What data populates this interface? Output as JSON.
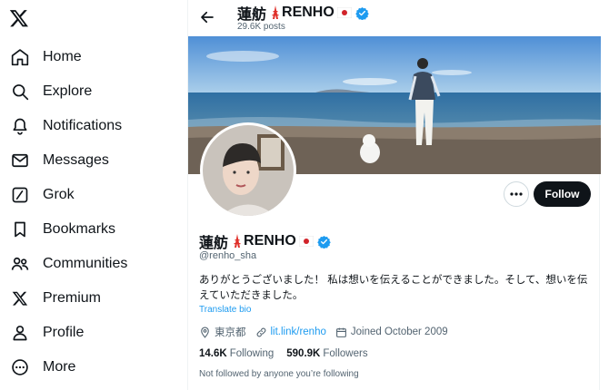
{
  "sidebar": {
    "items": [
      {
        "label": "Home",
        "icon": "home-icon"
      },
      {
        "label": "Explore",
        "icon": "search-icon"
      },
      {
        "label": "Notifications",
        "icon": "bell-icon"
      },
      {
        "label": "Messages",
        "icon": "envelope-icon"
      },
      {
        "label": "Grok",
        "icon": "grok-icon"
      },
      {
        "label": "Bookmarks",
        "icon": "bookmark-icon"
      },
      {
        "label": "Communities",
        "icon": "people-icon"
      },
      {
        "label": "Premium",
        "icon": "x-logo-icon"
      },
      {
        "label": "Profile",
        "icon": "person-icon"
      },
      {
        "label": "More",
        "icon": "more-circle-icon"
      }
    ]
  },
  "header": {
    "name": "蓮舫",
    "name_suffix": "RENHO",
    "posts": "29.6K posts"
  },
  "profile": {
    "name": "蓮舫",
    "name_suffix": "RENHO",
    "handle": "@renho_sha",
    "bio": "ありがとうございました！ 私は想いを伝えることができました。そして、想いを伝えていただきました。",
    "translate": "Translate bio",
    "location": "東京都",
    "link": "lit.link/renho",
    "joined": "Joined October 2009",
    "following_count": "14.6K",
    "following_label": "Following",
    "followers_count": "590.9K",
    "followers_label": "Followers",
    "not_followed": "Not followed by anyone you’re following",
    "follow_label": "Follow"
  },
  "colors": {
    "accent": "#1d9bf0",
    "text": "#0f1419",
    "muted": "#536471",
    "follow_bg": "#0f1419"
  }
}
